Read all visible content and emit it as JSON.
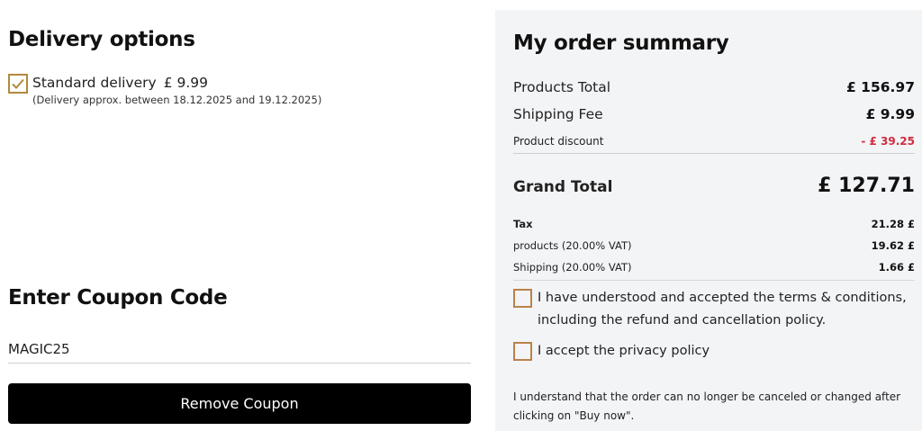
{
  "delivery": {
    "heading": "Delivery options",
    "option_label": "Standard delivery",
    "option_price": "£ 9.99",
    "option_note": "(Delivery approx. between 18.12.2025 and 19.12.2025)",
    "checked": true
  },
  "coupon": {
    "heading": "Enter Coupon Code",
    "value": "MAGIC25",
    "button_label": "Remove Coupon"
  },
  "summary": {
    "heading": "My order summary",
    "products_total_label": "Products Total",
    "products_total_value": "£ 156.97",
    "shipping_fee_label": "Shipping Fee",
    "shipping_fee_value": "£ 9.99",
    "discount_label": "Product discount",
    "discount_value": "- £ 39.25",
    "grand_total_label": "Grand Total",
    "grand_total_value": "£ 127.71",
    "tax_label": "Tax",
    "tax_value": "21.28 £",
    "vat_products_label": "products (20.00% VAT)",
    "vat_products_value": "19.62 £",
    "vat_shipping_label": "Shipping (20.00% VAT)",
    "vat_shipping_value": "1.66 £",
    "terms_line1": "I have understood and accepted the terms & conditions,",
    "terms_line2": "including the refund and cancellation policy.",
    "privacy_label": "I accept the privacy policy",
    "note_line1": "I understand that the order can no longer be canceled or changed after",
    "note_line2": "clicking on \"Buy now\"."
  },
  "colors": {
    "accent_checkbox": "#b08a3e",
    "discount_red": "#d12b3f",
    "panel_bg": "#f3f4f6",
    "button_bg": "#000000"
  }
}
